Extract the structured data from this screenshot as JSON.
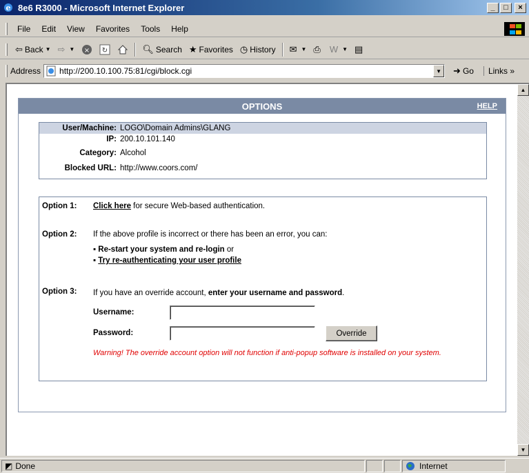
{
  "window": {
    "title": "8e6 R3000 - Microsoft Internet Explorer",
    "min": "_",
    "max": "□",
    "close": "×"
  },
  "menu": {
    "file": "File",
    "edit": "Edit",
    "view": "View",
    "favorites": "Favorites",
    "tools": "Tools",
    "help": "Help"
  },
  "toolbar": {
    "back": "Back",
    "search": "Search",
    "favorites": "Favorites",
    "history": "History"
  },
  "address": {
    "label": "Address",
    "url": "http://200.10.100.75:81/cgi/block.cgi",
    "go": "Go",
    "links": "Links"
  },
  "page": {
    "header": "OPTIONS",
    "help": "HELP",
    "info": {
      "user_label": "User/Machine:",
      "user_value": "LOGO\\Domain Admins\\GLANG",
      "ip_label": "IP:",
      "ip_value": "200.10.101.140",
      "category_label": "Category:",
      "category_value": "Alcohol",
      "url_label": "Blocked URL:",
      "url_value": "http://www.coors.com/"
    },
    "option1": {
      "label": "Option 1:",
      "link": "Click here",
      "text": " for secure Web-based authentication."
    },
    "option2": {
      "label": "Option 2:",
      "text": "If the above profile is incorrect or there has been an error, you can:",
      "bullet1": "Re-start your system and re-login",
      "bullet1_suffix": " or",
      "bullet2": "Try re-authenticating your user profile"
    },
    "option3": {
      "label": "Option 3:",
      "text": "If you have an override account, ",
      "text_bold": "enter your username and password",
      "text_end": ".",
      "username_label": "Username:",
      "password_label": "Password:",
      "override_button": "Override",
      "warning": "Warning! The override account option will not function if anti-popup software is installed on your system."
    }
  },
  "status": {
    "text": "Done",
    "zone": "Internet"
  }
}
